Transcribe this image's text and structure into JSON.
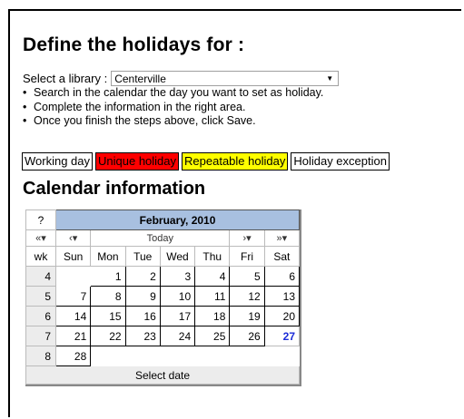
{
  "page": {
    "title": "Define the holidays for :",
    "library_label": "Select a library :",
    "library_value": "Centerville",
    "steps": [
      "Search in the calendar the day you want to set as holiday.",
      "Complete the information in the right area.",
      "Once you finish the steps above, click Save."
    ],
    "legend": [
      {
        "label": "Working day",
        "color": "#ffffff"
      },
      {
        "label": "Unique holiday",
        "color": "#ff0000"
      },
      {
        "label": "Repeatable holiday",
        "color": "#ffff00"
      },
      {
        "label": "Holiday exception",
        "color": "#ffffff"
      }
    ],
    "calendar_title": "Calendar information"
  },
  "calendar": {
    "help": "?",
    "month": "February, 2010",
    "nav": {
      "prev_year": "«",
      "prev_month": "‹",
      "today": "Today",
      "next_month": "›",
      "next_year": "»"
    },
    "headers": [
      "wk",
      "Sun",
      "Mon",
      "Tue",
      "Wed",
      "Thu",
      "Fri",
      "Sat"
    ],
    "weeks": [
      {
        "wk": "4",
        "days": [
          "",
          "1",
          "2",
          "3",
          "4",
          "5",
          "6"
        ]
      },
      {
        "wk": "5",
        "days": [
          "7",
          "8",
          "9",
          "10",
          "11",
          "12",
          "13"
        ]
      },
      {
        "wk": "6",
        "days": [
          "14",
          "15",
          "16",
          "17",
          "18",
          "19",
          "20"
        ]
      },
      {
        "wk": "7",
        "days": [
          "21",
          "22",
          "23",
          "24",
          "25",
          "26",
          "27"
        ]
      },
      {
        "wk": "8",
        "days": [
          "28",
          "",
          "",
          "",
          "",
          "",
          ""
        ]
      }
    ],
    "today": "27",
    "footer": "Select date",
    "colors": {
      "month_bg": "#a8c0e0",
      "today": "#1b2bd8"
    }
  }
}
